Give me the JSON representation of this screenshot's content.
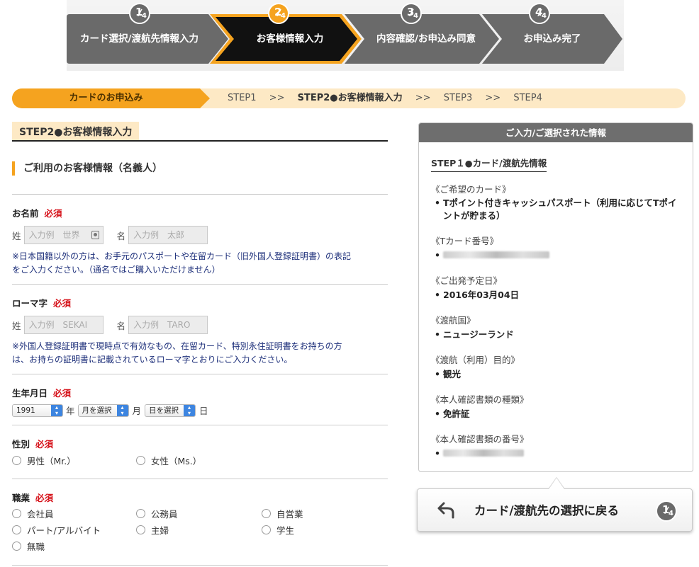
{
  "progress": {
    "steps": [
      {
        "num": "1",
        "total": "4",
        "label": "カード選択/渡航先情報入力",
        "active": false
      },
      {
        "num": "2",
        "total": "4",
        "label": "お客様情報入力",
        "active": true
      },
      {
        "num": "3",
        "total": "4",
        "label": "内容確認/お申込み同意",
        "active": false
      },
      {
        "num": "4",
        "total": "4",
        "label": "お申込み完了",
        "active": false
      }
    ]
  },
  "breadcrumb": {
    "tab": "カードのお申込み",
    "step1": "STEP1",
    "sep": ">>",
    "step2": "STEP2●お客様情報入力",
    "step3": "STEP3",
    "step4": "STEP4"
  },
  "form": {
    "section_title": "STEP2●お客様情報入力",
    "subsection_title": "ご利用のお客様情報（名義人）",
    "required": "必須",
    "name": {
      "label": "お名前",
      "last_prefix": "姓",
      "last_placeholder": "入力例　世界",
      "first_prefix": "名",
      "first_placeholder": "入力例　太郎",
      "note_line1": "※日本国籍以外の方は、お手元のパスポートや在留カード（旧外国人登録証明書）の表記",
      "note_line2": "をご入力ください。（通名ではご購入いただけません）"
    },
    "romaji": {
      "label": "ローマ字",
      "last_prefix": "姓",
      "last_placeholder": "入力例　SEKAI",
      "first_prefix": "名",
      "first_placeholder": "入力例　TARO",
      "note_line1": "※外国人登録証明書で現時点で有効なもの、在留カード、特別永住証明書をお持ちの方",
      "note_line2": "は、お持ちの証明書に記載されているローマ字とおりにご入力ください。"
    },
    "birthdate": {
      "label": "生年月日",
      "year_value": "1991",
      "year_unit": "年",
      "month_value": "月を選択",
      "month_unit": "月",
      "day_value": "日を選択",
      "day_unit": "日"
    },
    "gender": {
      "label": "性別",
      "options": [
        "男性（Mr.）",
        "女性（Ms.）"
      ]
    },
    "occupation": {
      "label": "職業",
      "options": [
        "会社員",
        "公務員",
        "自営業",
        "パート/アルバイト",
        "主婦",
        "学生",
        "無職"
      ]
    }
  },
  "summary": {
    "header": "ご入力/ご選択された情報",
    "step_title": "STEP１●カード/渡航先情報",
    "items": [
      {
        "q": "《ご希望のカード》",
        "a": "Tポイント付きキャッシュパスポート（利用に応じてTポイントが貯まる）"
      },
      {
        "q": "《Tカード番号》",
        "a": ""
      },
      {
        "q": "《ご出発予定日》",
        "a": "2016年03月04日"
      },
      {
        "q": "《渡航国》",
        "a": "ニュージーランド"
      },
      {
        "q": "《渡航（利用）目的》",
        "a": "観光"
      },
      {
        "q": "《本人確認書類の種類》",
        "a": "免許証"
      },
      {
        "q": "《本人確認書類の番号》",
        "a": ""
      }
    ],
    "bullet": "•"
  },
  "back_button": {
    "label": "カード/渡航先の選択に戻る",
    "badge_num": "1",
    "badge_total": "4"
  },
  "colors": {
    "accent": "#f5a31f",
    "step_gray": "#6a6a6a",
    "step_active": "#111111",
    "required_red": "#d6141c",
    "note_blue": "#1d2f7a"
  }
}
